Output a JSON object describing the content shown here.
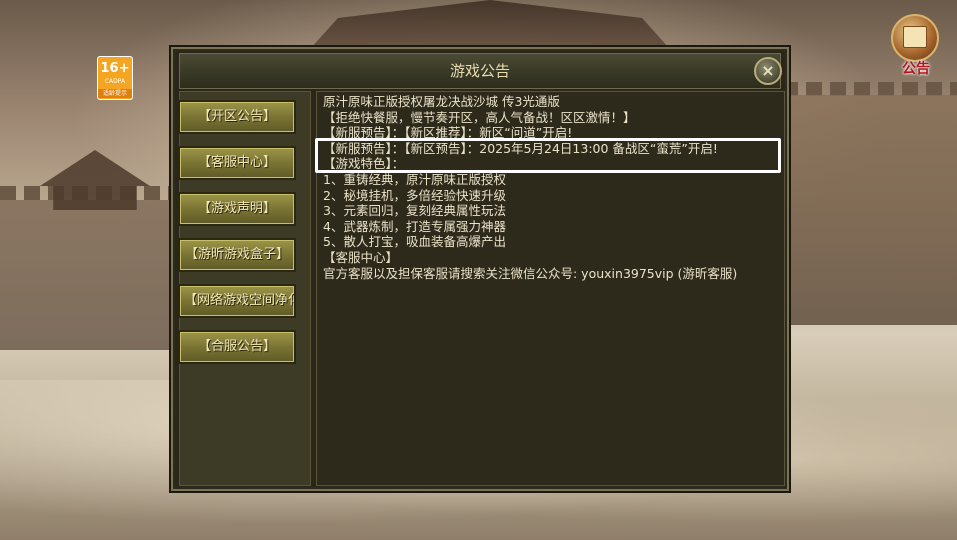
{
  "age_rating": {
    "number": "16+",
    "org": "CADPA",
    "note": "适龄提示"
  },
  "notice_button": {
    "label": "公告"
  },
  "panel": {
    "title": "游戏公告",
    "close_symbol": "×"
  },
  "sidebar": {
    "items": [
      {
        "label": "【开区公告】"
      },
      {
        "label": "【客服中心】"
      },
      {
        "label": "【游戏声明】"
      },
      {
        "label": "【游昕游戏盒子】"
      },
      {
        "label": "【网络游戏空间净化"
      },
      {
        "label": "【合服公告】"
      }
    ]
  },
  "content": {
    "lines": [
      "原汁原味正版授权屠龙决战沙城 传3光通版",
      "【拒绝快餐服，慢节奏开区，高人气备战！区区激情！】",
      "【新服预告】：【新区推荐】：新区“问道”开启!",
      "【新服预告】：【新区预告】：2025年5月24日13:00 备战区“蛮荒”开启!",
      "【游戏特色】：",
      "1、重铸经典，原汁原味正版授权",
      "2、秘境挂机，多倍经验快速升级",
      "3、元素回归，复刻经典属性玩法",
      "4、武器炼制，打造专属强力神器",
      "5、散人打宝，吸血装备高爆产出",
      "【客服中心】",
      "官方客服以及担保客服请搜索关注微信公众号: youxin3975vip (游昕客服)"
    ]
  },
  "colors": {
    "panel_bg": "#2a271a",
    "button_gold": "#7a7434",
    "text": "#e9e2c9",
    "highlight": "#ffffff"
  }
}
